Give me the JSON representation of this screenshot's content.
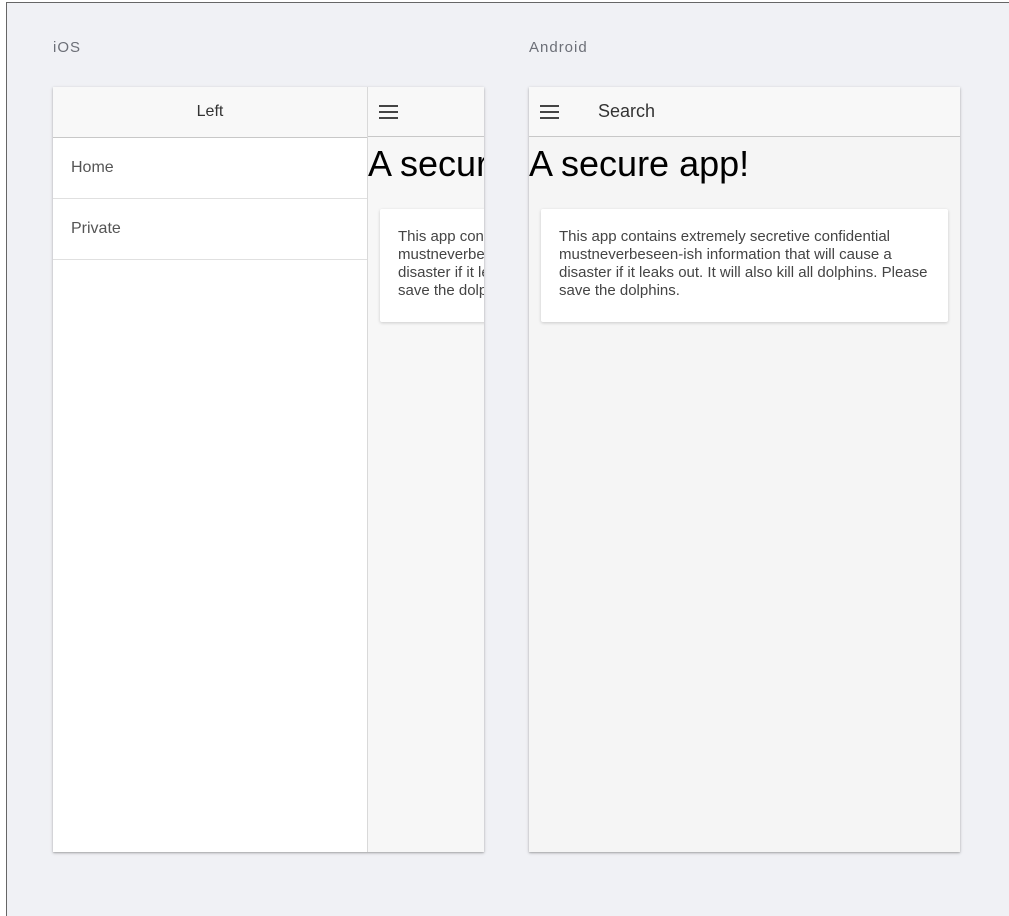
{
  "ios": {
    "platform_label": "iOS",
    "menu": {
      "header": "Left",
      "items": [
        {
          "label": "Home"
        },
        {
          "label": "Private"
        }
      ]
    },
    "page": {
      "title": "A secure app!",
      "body": "This app contains extremely secretive confidential mustneverbeseen-ish information that will cause a disaster if it leaks out. It will also kill all dolphins. Please save the dolphins."
    }
  },
  "android": {
    "platform_label": "Android",
    "toolbar": {
      "title": "Search"
    },
    "page": {
      "title": "A secure app!",
      "body": "This app contains extremely secretive confidential mustneverbeseen-ish information that will cause a disaster if it leaks out. It will also kill all dolphins. Please save the dolphins."
    }
  },
  "icons": {
    "menu": "hamburger-menu-icon"
  }
}
